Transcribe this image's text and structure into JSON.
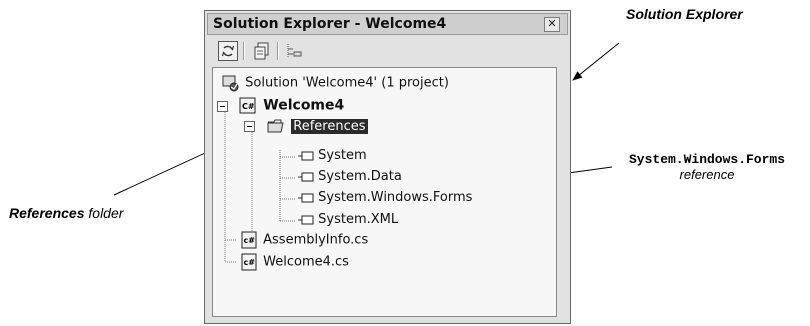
{
  "window": {
    "title": "Solution Explorer - Welcome4",
    "close_glyph": "✕"
  },
  "toolbar": [
    {
      "icon": "refresh-icon"
    },
    {
      "icon": "properties-icon"
    },
    {
      "icon": "show-all-files-icon"
    }
  ],
  "tree": {
    "solution": "Solution 'Welcome4' (1 project)",
    "project": "Welcome4",
    "references": "References",
    "ref_items": [
      "System",
      "System.Data",
      "System.Windows.Forms",
      "System.XML"
    ],
    "files": [
      "AssemblyInfo.cs",
      "Welcome4.cs"
    ]
  },
  "annotations": {
    "solution_explorer": "Solution Explorer",
    "references_bold": "References",
    "references_rest": " folder",
    "swf_code": "System.Windows.Forms",
    "swf_sub": "reference"
  }
}
